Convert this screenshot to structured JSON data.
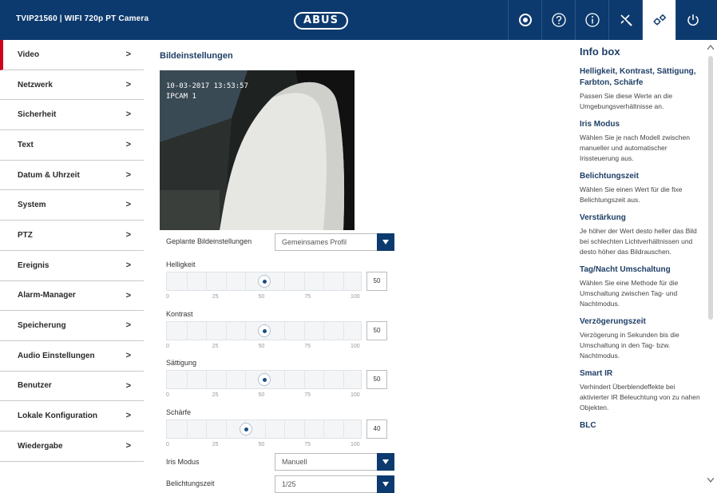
{
  "header": {
    "device_title": "TVIP21560  |  WIFI 720p PT Camera",
    "logo_text": "ABUS",
    "icons": [
      "camera-lens-icon",
      "help-icon",
      "info-icon",
      "tools-icon",
      "settings-gear-icon",
      "power-icon"
    ],
    "active_icon": "settings-gear-icon"
  },
  "sidebar": {
    "items": [
      {
        "label": "Video",
        "active": true
      },
      {
        "label": "Netzwerk"
      },
      {
        "label": "Sicherheit"
      },
      {
        "label": "Text"
      },
      {
        "label": "Datum & Uhrzeit"
      },
      {
        "label": "System"
      },
      {
        "label": "PTZ"
      },
      {
        "label": "Ereignis"
      },
      {
        "label": "Alarm-Manager"
      },
      {
        "label": "Speicherung"
      },
      {
        "label": "Audio Einstellungen"
      },
      {
        "label": "Benutzer"
      },
      {
        "label": "Lokale Konfiguration"
      },
      {
        "label": "Wiedergabe"
      }
    ],
    "chevron": ">"
  },
  "main": {
    "title": "Bildeinstellungen",
    "preview_overlay": {
      "datetime": "10-03-2017 13:53:57",
      "camera": "IPCAM 1"
    },
    "scheduled": {
      "label": "Geplante Bildeinstellungen",
      "value": "Gemeinsames Profil"
    },
    "sliders": [
      {
        "label": "Helligkeit",
        "value": "50",
        "level": 50
      },
      {
        "label": "Kontrast",
        "value": "50",
        "level": 50
      },
      {
        "label": "Sättigung",
        "value": "50",
        "level": 50
      },
      {
        "label": "Schärfe",
        "value": "40",
        "level": 40
      }
    ],
    "scale_marks": [
      "0",
      "25",
      "50",
      "75",
      "100"
    ],
    "iris": {
      "label": "Iris Modus",
      "value": "Manuell"
    },
    "exposure": {
      "label": "Belichtungszeit",
      "value": "1/25"
    }
  },
  "infobox": {
    "title": "Info box",
    "sections": [
      {
        "head": "Helligkeit, Kontrast, Sättigung, Farbton, Schärfe",
        "text": "Passen Sie diese Werte an die Umgebungsverhältnisse an."
      },
      {
        "head": "Iris Modus",
        "text": "Wählen Sie je nach Modell zwischen manueller und automatischer Irissteuerung aus."
      },
      {
        "head": "Belichtungszeit",
        "text": "Wählen Sie einen Wert für die fixe Belichtungszeit aus."
      },
      {
        "head": "Verstärkung",
        "text": "Je höher der Wert desto heller das Bild bei schlechten Lichtverhältnissen und desto höher das Bildrauschen."
      },
      {
        "head": "Tag/Nacht Umschaltung",
        "text": "Wählen Sie eine Methode für die Umschaltung zwischen Tag- und Nachtmodus."
      },
      {
        "head": "Verzögerungszeit",
        "text": "Verzögerung in Sekunden bis die Umschaltung in den Tag- bzw. Nachtmodus."
      },
      {
        "head": "Smart IR",
        "text": "Verhindert Überblendeffekte bei aktivierter IR Beleuchtung von zu nahen Objekten."
      },
      {
        "head": "BLC",
        "text": ""
      }
    ]
  },
  "colors": {
    "header_bg": "#0d3a6e",
    "active_marker": "#d0021b",
    "accent": "#1f3f66"
  }
}
